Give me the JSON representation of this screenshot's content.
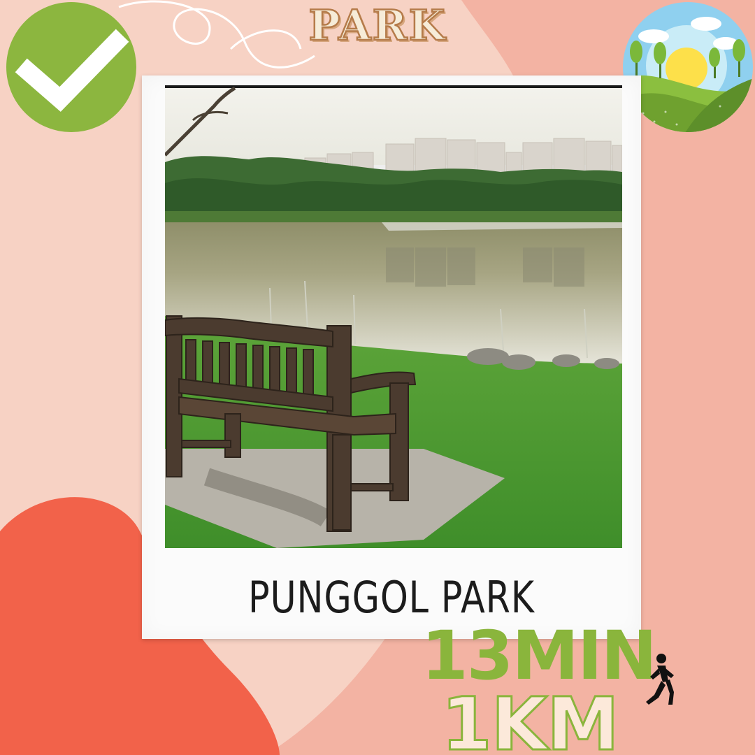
{
  "header": {
    "title": "PARK"
  },
  "card": {
    "caption": "PUNGGOL PARK"
  },
  "stats": {
    "walk_time": "13MIN",
    "distance": "1KM"
  },
  "icons": [
    "check-mark-icon",
    "landscape-icon",
    "walking-person-icon"
  ],
  "colors": {
    "background": "#f7d2c4",
    "blob_pink": "#f3b3a3",
    "blob_red": "#f2624a",
    "accent_green": "#8ab53c",
    "check_green": "#8cb63f",
    "title_fill": "#f6ecd8",
    "title_outline": "#b57b4a"
  }
}
